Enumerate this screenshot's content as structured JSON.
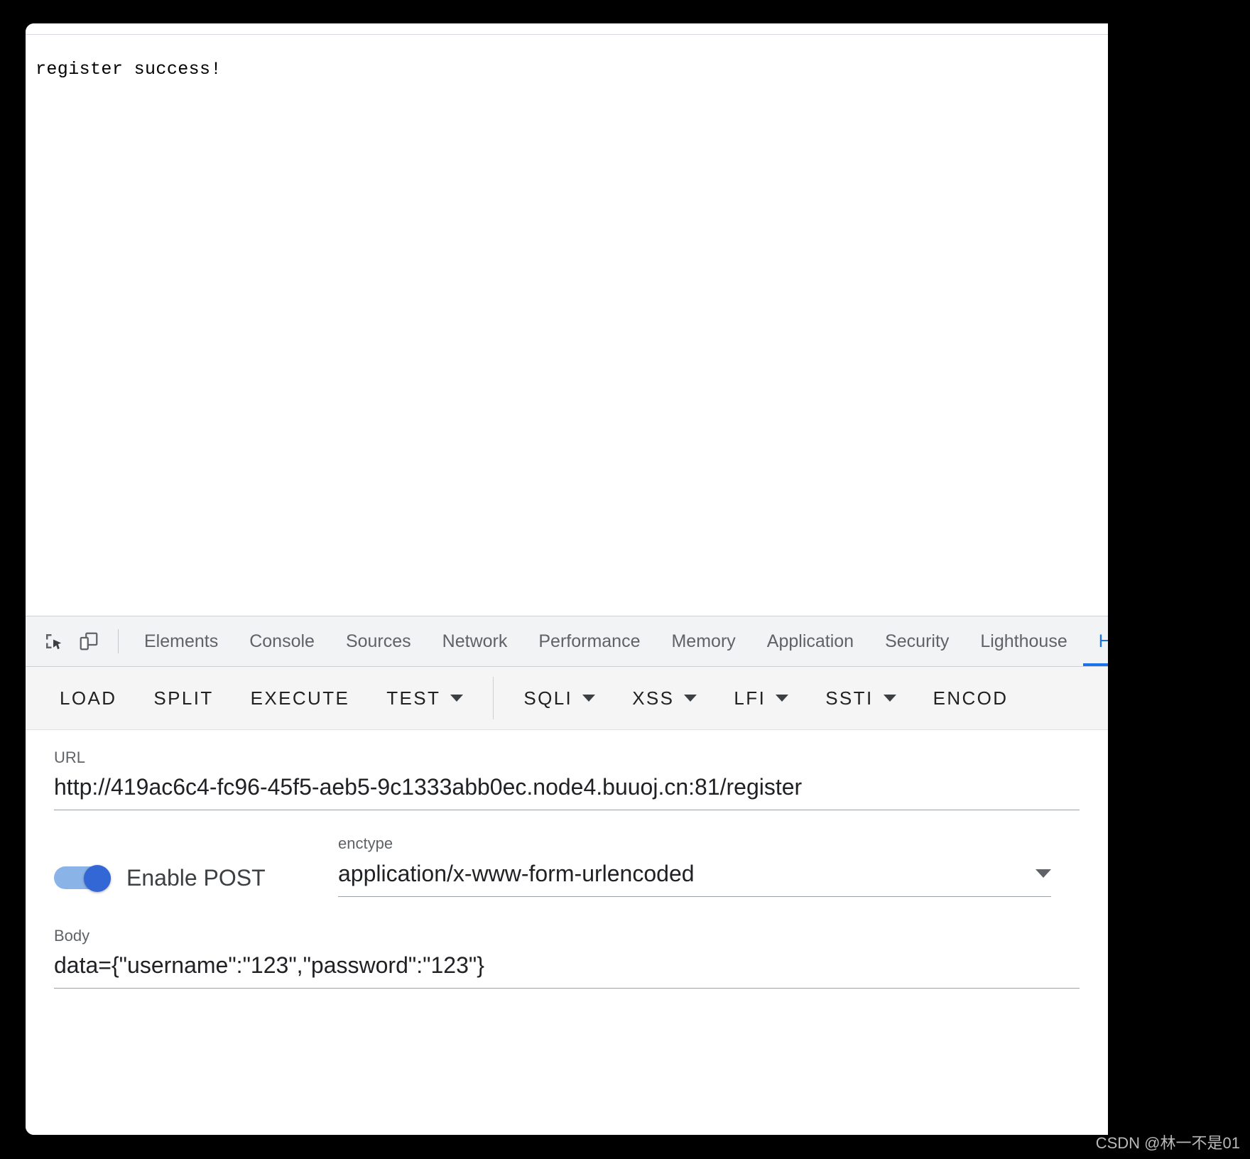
{
  "page": {
    "rendered_text": "register success!"
  },
  "devtools": {
    "icons": {
      "inspect": "inspect-element-icon",
      "device": "device-toolbar-icon"
    },
    "tabs": [
      {
        "label": "Elements",
        "active": false
      },
      {
        "label": "Console",
        "active": false
      },
      {
        "label": "Sources",
        "active": false
      },
      {
        "label": "Network",
        "active": false
      },
      {
        "label": "Performance",
        "active": false
      },
      {
        "label": "Memory",
        "active": false
      },
      {
        "label": "Application",
        "active": false
      },
      {
        "label": "Security",
        "active": false
      },
      {
        "label": "Lighthouse",
        "active": false
      },
      {
        "label": "H",
        "active": true
      }
    ]
  },
  "hackbar": {
    "toolbar": [
      {
        "label": "LOAD",
        "dropdown": false
      },
      {
        "label": "SPLIT",
        "dropdown": false
      },
      {
        "label": "EXECUTE",
        "dropdown": false
      },
      {
        "label": "TEST",
        "dropdown": true
      },
      {
        "label": "SQLI",
        "dropdown": true
      },
      {
        "label": "XSS",
        "dropdown": true
      },
      {
        "label": "LFI",
        "dropdown": true
      },
      {
        "label": "SSTI",
        "dropdown": true
      },
      {
        "label": "ENCOD",
        "dropdown": false
      }
    ],
    "url": {
      "label": "URL",
      "value": "http://419ac6c4-fc96-45f5-aeb5-9c1333abb0ec.node4.buuoj.cn:81/register"
    },
    "post": {
      "label": "Enable POST",
      "enabled": true
    },
    "enctype": {
      "label": "enctype",
      "value": "application/x-www-form-urlencoded"
    },
    "body": {
      "label": "Body",
      "value": "data={\"username\":\"123\",\"password\":\"123\"}"
    }
  },
  "watermark": {
    "text": "CSDN @林一不是01"
  },
  "colors": {
    "accent": "#1a73e8",
    "toggle_track": "#8ab4e8",
    "toggle_thumb": "#3367d6",
    "toolbar_bg": "#f5f5f5",
    "tabbar_bg": "#f1f3f4"
  }
}
